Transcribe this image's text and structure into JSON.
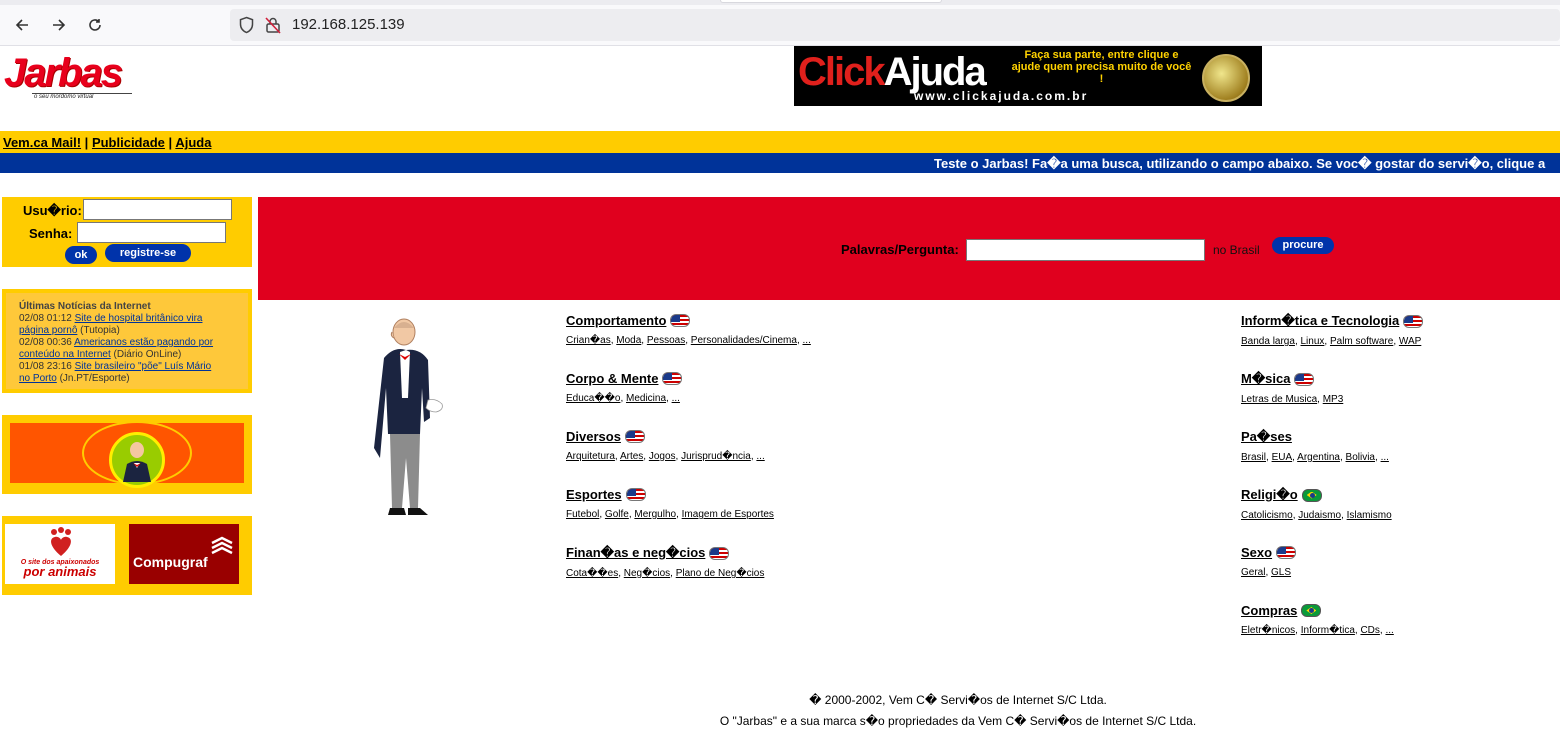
{
  "browser": {
    "url": "192.168.125.139",
    "back_icon": "arrow-left-icon",
    "forward_icon": "arrow-right-icon",
    "reload_icon": "reload-icon"
  },
  "logo": {
    "word": "Jarbas",
    "tagline": "o seu mordomo virtual"
  },
  "banner": {
    "brand_part1": "Click",
    "brand_part2": "Ajuda",
    "promo": "Faça sua parte, entre clique e ajude quem precisa muito de você !",
    "url": "www.clickajuda.com.br"
  },
  "topnav": {
    "mail": "Vem.ca Mail!",
    "sep": "|",
    "ads": "Publicidade",
    "help": "Ajuda"
  },
  "marquee": "Teste o Jarbas! Fa�a uma busca, utilizando o campo abaixo. Se voc� gostar do servi�o, clique a",
  "login": {
    "user_label": "Usu�rio:",
    "pass_label": "Senha:",
    "ok": "ok",
    "register": "registre-se"
  },
  "news": {
    "heading": "Últimas Notícias da Internet",
    "items": [
      {
        "time": "02/08 01:12",
        "title_a": "Site de hospital britânico vira",
        "title_b": "página pornô",
        "source": "(Tutopia)"
      },
      {
        "time": "02/08 00:36",
        "title_a": "Americanos estão pagando por",
        "title_b": "conteúdo na Internet",
        "source": "(Diário OnLine)"
      },
      {
        "time": "01/08 23:16",
        "title_a": "Site brasileiro \"põe\" Luís Mário",
        "title_b": "no Porto",
        "source": "(Jn.PT/Esporte)"
      }
    ]
  },
  "sponsors": {
    "animais_small": "O site dos apaixonados",
    "animais_big": "por animais",
    "compugraf": "Compugraf"
  },
  "search": {
    "label": "Palavras/Pergunta:",
    "scope": "no Brasil",
    "button": "procure"
  },
  "categories_left": [
    {
      "title": "Comportamento",
      "flag": "us",
      "links": [
        "Crian�as",
        "Moda",
        "Pessoas",
        "Personalidades/Cinema",
        "..."
      ]
    },
    {
      "title": "Corpo & Mente",
      "flag": "us",
      "links": [
        "Educa��o",
        "Medicina",
        "..."
      ]
    },
    {
      "title": "Diversos",
      "flag": "us",
      "links": [
        "Arquitetura",
        "Artes",
        "Jogos",
        "Jurisprud�ncia",
        "..."
      ]
    },
    {
      "title": "Esportes",
      "flag": "us",
      "links": [
        "Futebol",
        "Golfe",
        "Mergulho",
        "Imagem de Esportes"
      ]
    },
    {
      "title": "Finan�as e neg�cios",
      "flag": "us",
      "links": [
        "Cota��es",
        "Neg�cios",
        "Plano de Neg�cios"
      ]
    }
  ],
  "categories_right": [
    {
      "title": "Inform�tica e Tecnologia",
      "flag": "us",
      "links": [
        "Banda larga",
        "Linux",
        "Palm software",
        "WAP"
      ]
    },
    {
      "title": "M�sica",
      "flag": "us",
      "links": [
        "Letras de Musica",
        "MP3"
      ]
    },
    {
      "title": "Pa�ses",
      "flag": "",
      "links": [
        "Brasil",
        "EUA",
        "Argentina",
        "Bolivia",
        "..."
      ]
    },
    {
      "title": "Religi�o",
      "flag": "br",
      "links": [
        "Catolicismo",
        "Judaismo",
        "Islamismo"
      ]
    },
    {
      "title": "Sexo",
      "flag": "us",
      "links": [
        "Geral",
        "GLS"
      ]
    },
    {
      "title": "Compras",
      "flag": "br",
      "links": [
        "Eletr�nicos",
        "Inform�tica",
        "CDs",
        "..."
      ]
    }
  ],
  "footer": {
    "line1": "� 2000-2002, Vem C� Servi�os de Internet S/C Ltda.",
    "line2": "O \"Jarbas\" e a sua marca s�o propriedades da Vem C� Servi�os de Internet S/C Ltda."
  }
}
